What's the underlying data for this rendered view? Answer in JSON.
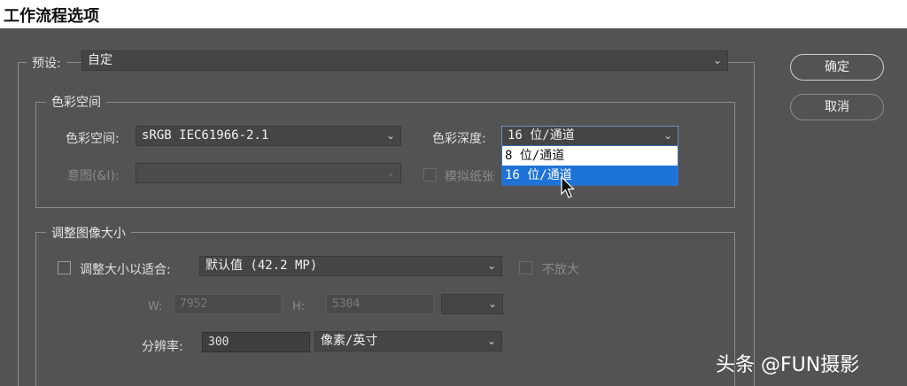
{
  "window": {
    "title": "工作流程选项"
  },
  "preset": {
    "label": "预设:",
    "value": "自定"
  },
  "buttons": {
    "ok": "确定",
    "cancel": "取消"
  },
  "color_space_group": {
    "legend": "色彩空间",
    "color_space_label": "色彩空间:",
    "color_space_value": "sRGB IEC61966-2.1",
    "intent_label": "意图(&I):",
    "intent_value": "",
    "color_depth_label": "色彩深度:",
    "color_depth_value": "16 位/通道",
    "simulate_paper_label": "模拟纸张",
    "depth_options": [
      "8 位/通道",
      "16 位/通道"
    ],
    "depth_selected_index": 1
  },
  "resize_group": {
    "legend": "调整图像大小",
    "resize_to_fit_label": "调整大小以适合:",
    "resize_to_fit_value": "默认值 (42.2 MP)",
    "no_enlarge_label": "不放大",
    "w_label": "W:",
    "w_value": "7952",
    "h_label": "H:",
    "h_value": "5304",
    "unit_value": "",
    "resolution_label": "分辨率:",
    "resolution_value": "300",
    "resolution_unit": "像素/英寸"
  },
  "watermark": {
    "text": "头条 @FUN摄影"
  },
  "colors": {
    "background": "#535353",
    "accent": "#1e73d6",
    "titlebar": "#ffffff"
  }
}
